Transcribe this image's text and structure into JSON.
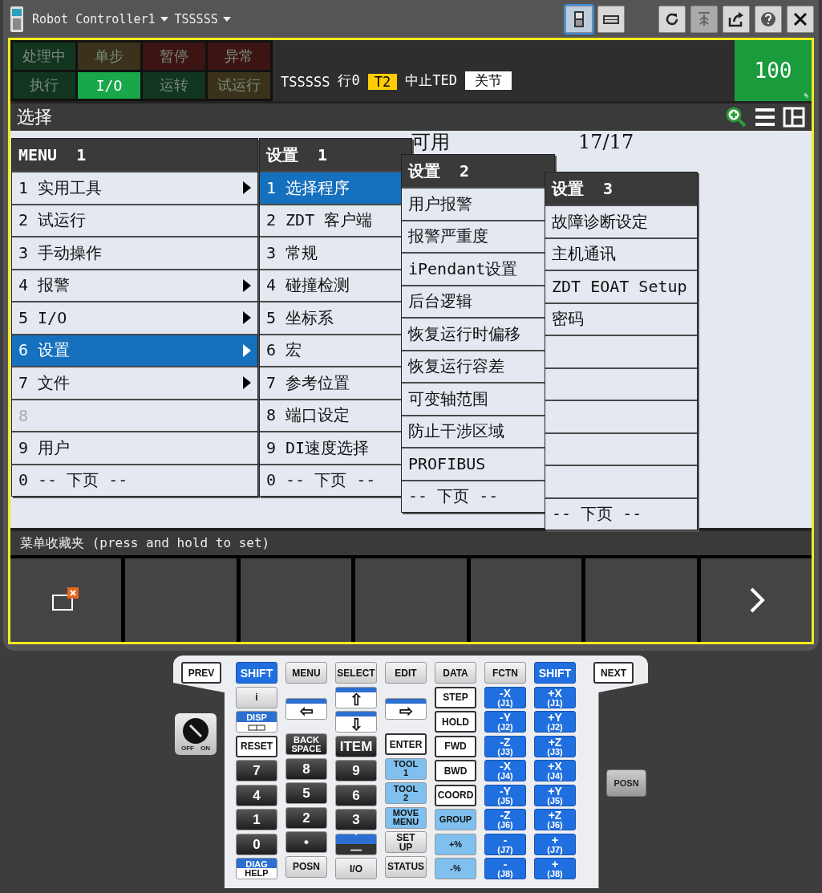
{
  "top_bar": {
    "title": "Robot Controller1",
    "target": "TSSSSS",
    "tools": [
      {
        "kind": "pendant",
        "selected": true
      },
      {
        "kind": "keyboard",
        "selected": false
      },
      {
        "kind": "refresh",
        "disabled": false
      },
      {
        "kind": "step",
        "disabled": true
      },
      {
        "kind": "export",
        "disabled": false
      },
      {
        "kind": "help",
        "disabled": false
      },
      {
        "kind": "close",
        "disabled": false
      }
    ]
  },
  "status": {
    "lamps": [
      {
        "label": "处理中",
        "on": false,
        "color": "#12351f"
      },
      {
        "label": "单步",
        "on": false,
        "color": "#3a321a"
      },
      {
        "label": "暂停",
        "on": false,
        "color": "#3d1414"
      },
      {
        "label": "异常",
        "on": false,
        "color": "#3d1414"
      },
      {
        "label": "执行",
        "on": false,
        "color": "#12351f"
      },
      {
        "label": "I/O",
        "on": true,
        "color": "#18a84a"
      },
      {
        "label": "运转",
        "on": false,
        "color": "#12351f"
      },
      {
        "label": "试运行",
        "on": false,
        "color": "#3a321a"
      }
    ],
    "program": "TSSSSS",
    "line": "行0",
    "mode": "T2",
    "state": "中止TED",
    "coord": "关节",
    "override": "100",
    "override_unit": "%"
  },
  "screen": {
    "title": "选择",
    "background_texts": [
      "可用",
      "17/17"
    ],
    "menus": [
      {
        "title": "MENU",
        "page": "1",
        "items": [
          {
            "label": "1 实用工具",
            "submenu": true,
            "selected": false,
            "disabled": false
          },
          {
            "label": "2 试运行",
            "submenu": false,
            "selected": false,
            "disabled": false
          },
          {
            "label": "3 手动操作",
            "submenu": false,
            "selected": false,
            "disabled": false
          },
          {
            "label": "4 报警",
            "submenu": true,
            "selected": false,
            "disabled": false
          },
          {
            "label": "5 I/O",
            "submenu": true,
            "selected": false,
            "disabled": false
          },
          {
            "label": "6 设置",
            "submenu": true,
            "selected": true,
            "disabled": false
          },
          {
            "label": "7 文件",
            "submenu": true,
            "selected": false,
            "disabled": false
          },
          {
            "label": "8",
            "submenu": false,
            "selected": false,
            "disabled": true
          },
          {
            "label": "9 用户",
            "submenu": false,
            "selected": false,
            "disabled": false
          },
          {
            "label": "0 -- 下页 --",
            "submenu": false,
            "selected": false,
            "disabled": false
          }
        ]
      },
      {
        "title": "设置",
        "page": "1",
        "items": [
          {
            "label": "1 选择程序",
            "selected": true
          },
          {
            "label": "2 ZDT 客户端",
            "selected": false
          },
          {
            "label": "3 常规",
            "selected": false
          },
          {
            "label": "4 碰撞检测",
            "selected": false
          },
          {
            "label": "5 坐标系",
            "selected": false
          },
          {
            "label": "6 宏",
            "selected": false
          },
          {
            "label": "7 参考位置",
            "selected": false
          },
          {
            "label": "8 端口设定",
            "selected": false
          },
          {
            "label": "9 DI速度选择",
            "selected": false
          },
          {
            "label": "0 -- 下页 --",
            "selected": false
          }
        ]
      },
      {
        "title": "设置",
        "page": "2",
        "items": [
          {
            "label": "用户报警",
            "selected": false
          },
          {
            "label": "报警严重度",
            "selected": false
          },
          {
            "label": "iPendant设置",
            "selected": false
          },
          {
            "label": "后台逻辑",
            "selected": false
          },
          {
            "label": "恢复运行时偏移",
            "selected": false
          },
          {
            "label": "恢复运行容差",
            "selected": false
          },
          {
            "label": "可变轴范围",
            "selected": false
          },
          {
            "label": "防止干涉区域",
            "selected": false
          },
          {
            "label": "PROFIBUS",
            "selected": false
          },
          {
            "label": "-- 下页 --",
            "selected": false
          }
        ]
      },
      {
        "title": "设置",
        "page": "3",
        "items": [
          {
            "label": "故障诊断设定",
            "selected": false
          },
          {
            "label": "主机通讯",
            "selected": false
          },
          {
            "label": "ZDT EOAT Setup",
            "selected": false
          },
          {
            "label": "密码",
            "selected": false
          },
          {
            "selected": false
          },
          {
            "selected": false
          },
          {
            "selected": false
          },
          {
            "selected": false
          },
          {
            "selected": false
          },
          {
            "label": "-- 下页 --",
            "selected": false
          }
        ]
      }
    ],
    "prompt": "菜单收藏夹 (press and hold to set)",
    "softkeys": [
      {
        "kind": "close-window"
      },
      {
        "kind": "blank"
      },
      {
        "kind": "blank"
      },
      {
        "kind": "blank"
      },
      {
        "kind": "blank"
      },
      {
        "kind": "blank"
      },
      {
        "kind": "next"
      }
    ]
  },
  "keypad": {
    "knob": {
      "labels": [
        "OFF",
        "ON"
      ],
      "on": true
    },
    "side_key": "POSN",
    "columns": [
      [
        {
          "kind": "white",
          "lines": [
            "PREV"
          ]
        }
      ],
      [
        {
          "kind": "blue",
          "lines": [
            "SHIFT"
          ]
        },
        {
          "kind": "gray",
          "lines": [
            "i"
          ]
        },
        {
          "kind": "disp-window",
          "lines": [
            "DISP"
          ]
        },
        {
          "kind": "white",
          "lines": [
            "RESET"
          ]
        },
        {
          "kind": "dark",
          "lines": [
            "7"
          ]
        },
        {
          "kind": "dark",
          "lines": [
            "4"
          ]
        },
        {
          "kind": "dark",
          "lines": [
            "1"
          ]
        },
        {
          "kind": "dark",
          "lines": [
            "0"
          ]
        },
        {
          "kind": "disp",
          "lines": [
            "DIAG",
            "HELP"
          ]
        }
      ],
      [
        {
          "kind": "gray",
          "lines": [
            "MENU"
          ]
        },
        {
          "kind": "arrow-tall",
          "lines": [
            "⇦"
          ]
        },
        {
          "kind": "dark",
          "lines": [
            "BACK",
            "SPACE"
          ]
        },
        {
          "kind": "dark",
          "lines": [
            "8"
          ]
        },
        {
          "kind": "dark",
          "lines": [
            "5"
          ]
        },
        {
          "kind": "dark",
          "lines": [
            "2"
          ]
        },
        {
          "kind": "dark",
          "lines": [
            "•"
          ]
        },
        {
          "kind": "gray",
          "lines": [
            "POSN"
          ]
        }
      ],
      [
        {
          "kind": "gray",
          "lines": [
            "SELECT"
          ]
        },
        {
          "kind": "arrow",
          "lines": [
            "⇧"
          ]
        },
        {
          "kind": "arrow",
          "lines": [
            "⇩"
          ]
        },
        {
          "kind": "dark",
          "lines": [
            "ITEM"
          ]
        },
        {
          "kind": "dark",
          "lines": [
            "9"
          ]
        },
        {
          "kind": "dark",
          "lines": [
            "6"
          ]
        },
        {
          "kind": "dark",
          "lines": [
            "3"
          ]
        },
        {
          "kind": "split",
          "lines": [
            "´",
            "—"
          ]
        },
        {
          "kind": "gray",
          "lines": [
            "I/O"
          ]
        }
      ],
      [
        {
          "kind": "gray",
          "lines": [
            "EDIT"
          ]
        },
        {
          "kind": "arrow-tall",
          "lines": [
            "⇨"
          ]
        },
        {
          "kind": "white",
          "lines": [
            "ENTER"
          ]
        },
        {
          "kind": "light",
          "lines": [
            "TOOL",
            "1"
          ]
        },
        {
          "kind": "light",
          "lines": [
            "TOOL",
            "2"
          ]
        },
        {
          "kind": "light",
          "lines": [
            "MOVE",
            "MENU"
          ]
        },
        {
          "kind": "gray",
          "lines": [
            "SET",
            "UP"
          ]
        },
        {
          "kind": "gray",
          "lines": [
            "STATUS"
          ]
        }
      ],
      [
        {
          "kind": "gray",
          "lines": [
            "DATA"
          ]
        },
        {
          "kind": "white",
          "lines": [
            "STEP"
          ]
        },
        {
          "kind": "white",
          "lines": [
            "HOLD"
          ]
        },
        {
          "kind": "white",
          "lines": [
            "FWD"
          ]
        },
        {
          "kind": "white",
          "lines": [
            "BWD"
          ]
        },
        {
          "kind": "white",
          "lines": [
            "COORD"
          ]
        },
        {
          "kind": "light",
          "lines": [
            "GROUP"
          ]
        },
        {
          "kind": "light",
          "lines": [
            "+%"
          ]
        },
        {
          "kind": "light",
          "lines": [
            "-%"
          ]
        }
      ],
      [
        {
          "kind": "gray",
          "lines": [
            "FCTN"
          ]
        },
        {
          "kind": "blue",
          "lines": [
            "-X",
            "(J1)"
          ]
        },
        {
          "kind": "blue",
          "lines": [
            "-Y",
            "(J2)"
          ]
        },
        {
          "kind": "blue",
          "lines": [
            "-Z",
            "(J3)"
          ]
        },
        {
          "kind": "blue",
          "lines": [
            "-X",
            "(J4)"
          ]
        },
        {
          "kind": "blue",
          "lines": [
            "-Y",
            "(J5)"
          ]
        },
        {
          "kind": "blue",
          "lines": [
            "-Z",
            "(J6)"
          ]
        },
        {
          "kind": "blue",
          "lines": [
            "-",
            "(J7)"
          ]
        },
        {
          "kind": "blue",
          "lines": [
            "-",
            "(J8)"
          ]
        }
      ],
      [
        {
          "kind": "blue",
          "lines": [
            "SHIFT"
          ]
        },
        {
          "kind": "blue",
          "lines": [
            "+X",
            "(J1)"
          ]
        },
        {
          "kind": "blue",
          "lines": [
            "+Y",
            "(J2)"
          ]
        },
        {
          "kind": "blue",
          "lines": [
            "+Z",
            "(J3)"
          ]
        },
        {
          "kind": "blue",
          "lines": [
            "+X",
            "(J4)"
          ]
        },
        {
          "kind": "blue",
          "lines": [
            "+Y",
            "(J5)"
          ]
        },
        {
          "kind": "blue",
          "lines": [
            "+Z",
            "(J6)"
          ]
        },
        {
          "kind": "blue",
          "lines": [
            "+",
            "(J7)"
          ]
        },
        {
          "kind": "blue",
          "lines": [
            "+",
            "(J8)"
          ]
        }
      ],
      [
        {
          "kind": "white",
          "lines": [
            "NEXT"
          ]
        }
      ]
    ]
  }
}
